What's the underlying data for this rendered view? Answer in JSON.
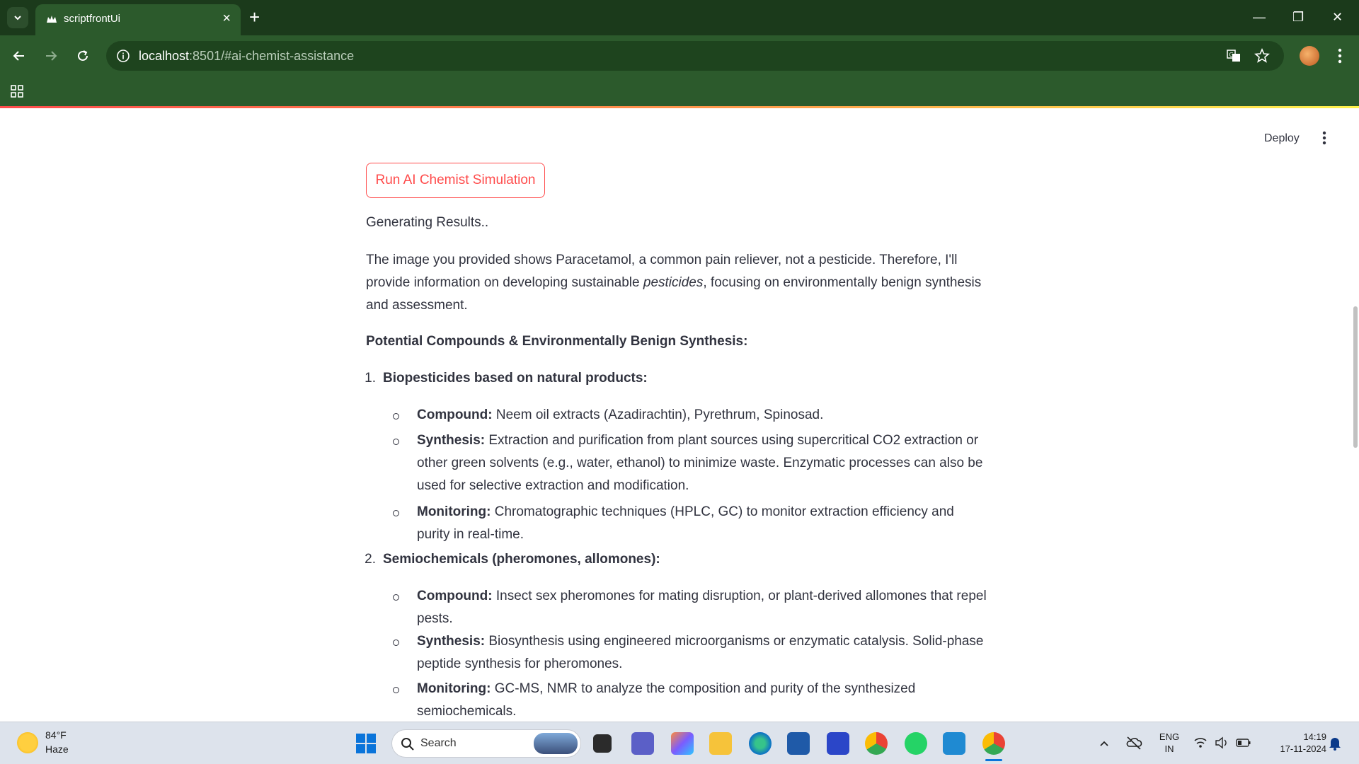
{
  "browser": {
    "tab_title": "scriptfrontUi",
    "url_host": "localhost",
    "url_rest": ":8501/#ai-chemist-assistance"
  },
  "app": {
    "deploy_label": "Deploy",
    "run_button": "Run AI Chemist Simulation",
    "status": "Generating Results..",
    "intro_part1": "The image you provided shows Paracetamol, a common pain reliever, not a pesticide. Therefore, I'll provide information on developing sustainable ",
    "intro_em": "pesticides",
    "intro_part2": ", focusing on environmentally benign synthesis and assessment.",
    "heading": "Potential Compounds & Environmentally Benign Synthesis:",
    "items": [
      {
        "num": "1.",
        "title": "Biopesticides based on natural products:",
        "bullets": [
          {
            "label": "Compound:",
            "text": " Neem oil extracts (Azadirachtin), Pyrethrum, Spinosad."
          },
          {
            "label": "Synthesis:",
            "text": " Extraction and purification from plant sources using supercritical CO2 extraction or other green solvents (e.g., water, ethanol) to minimize waste. Enzymatic processes can also be used for selective extraction and modification."
          },
          {
            "label": "Monitoring:",
            "text": " Chromatographic techniques (HPLC, GC) to monitor extraction efficiency and purity in real-time."
          }
        ]
      },
      {
        "num": "2.",
        "title": "Semiochemicals (pheromones, allomones):",
        "bullets": [
          {
            "label": "Compound:",
            "text": " Insect sex pheromones for mating disruption, or plant-derived allomones that repel pests."
          },
          {
            "label": "Synthesis:",
            "text": " Biosynthesis using engineered microorganisms or enzymatic catalysis. Solid-phase peptide synthesis for pheromones."
          },
          {
            "label": "Monitoring:",
            "text": " GC-MS, NMR to analyze the composition and purity of the synthesized semiochemicals."
          }
        ]
      }
    ]
  },
  "taskbar": {
    "weather_temp": "84°F",
    "weather_desc": "Haze",
    "search_placeholder": "Search",
    "lang_top": "ENG",
    "lang_bottom": "IN",
    "time": "14:19",
    "date": "17-11-2024"
  },
  "colors": {
    "chrome_dark": "#1b3a1b",
    "chrome": "#2c5a2c",
    "accent": "#ff4b4b"
  }
}
